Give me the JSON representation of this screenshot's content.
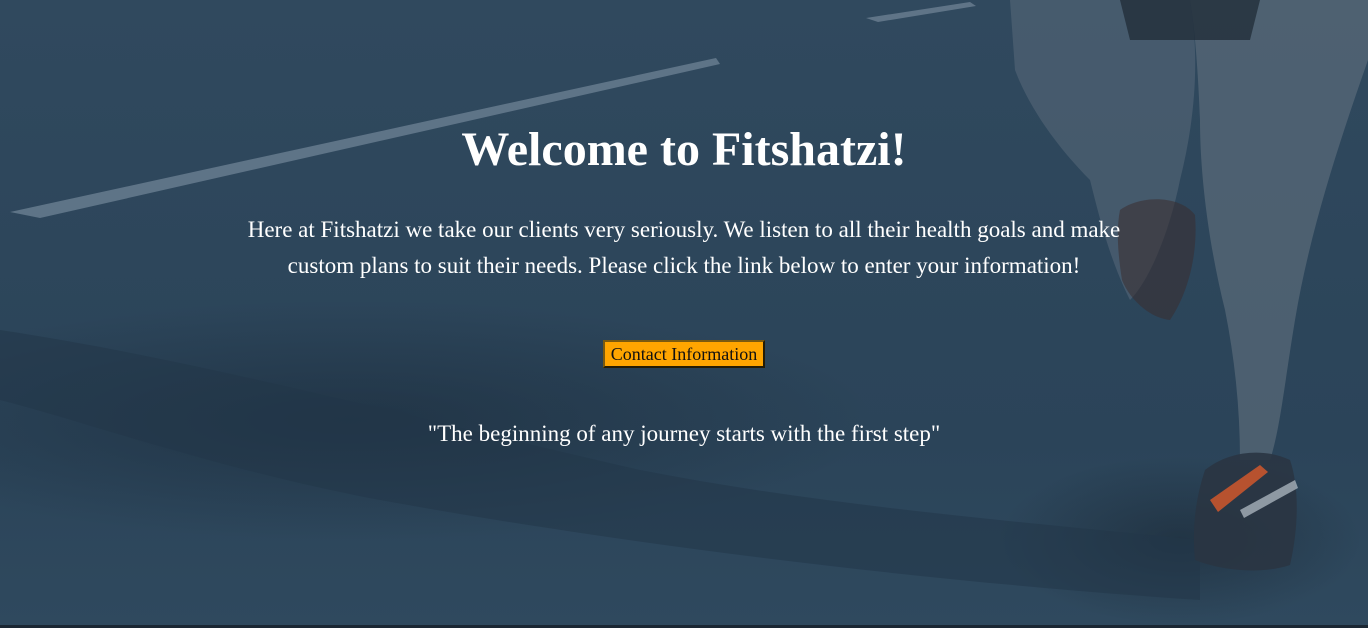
{
  "hero": {
    "title": "Welcome to Fitshatzi!",
    "intro": "Here at Fitshatzi we take our clients very seriously. We listen to all their health goals and make custom plans to suit their needs. Please click the link below to enter your information!",
    "cta_label": "Contact Information",
    "quote": "\"The beginning of any journey starts with the first step\""
  },
  "colors": {
    "overlay": "#2d465b",
    "cta_background": "#ffa500",
    "text": "#ffffff"
  }
}
